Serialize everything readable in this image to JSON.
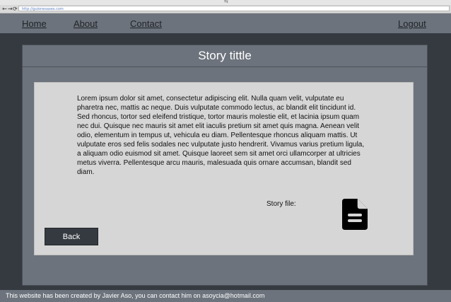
{
  "browser": {
    "url": "http://guionesaxes.com",
    "back_icon": "←",
    "forward_icon": "→",
    "reload_icon": "⟳",
    "top_mark": "⇆"
  },
  "nav": {
    "home": "Home",
    "about": "About",
    "contact": "Contact",
    "logout": "Logout"
  },
  "story": {
    "title": "Story tittle",
    "body": "Lorem ipsum dolor sit amet, consectetur adipiscing elit. Nulla quam velit, vulputate eu pharetra nec, mattis ac neque. Duis vulputate commodo lectus, ac blandit elit tincidunt id. Sed rhoncus, tortor sed eleifend tristique, tortor mauris molestie elit, et lacinia ipsum quam nec dui. Quisque nec mauris sit amet elit iaculis pretium sit amet quis magna. Aenean velit odio, elementum in tempus ut, vehicula eu diam. Pellentesque rhoncus aliquam mattis. Ut vulputate eros sed felis sodales nec vulputate justo hendrerit. Vivamus varius pretium ligula, a aliquam odio euismod sit amet. Quisque laoreet sem sit amet orci ullamcorper at ultricies metus viverra. Pellentesque arcu mauris, malesuada quis ornare accumsan, blandit sed diam.",
    "file_label": "Story file:",
    "file_icon": "document-icon",
    "back_label": "Back"
  },
  "footer": {
    "text": "This website has been created by Javier Aso, you can contact him on asoycia@hotmail.com"
  },
  "colors": {
    "page_bg": "#343a40",
    "panel_bg": "#6c737c",
    "card_bg": "#d6d6d6",
    "button_bg": "#343a40"
  }
}
